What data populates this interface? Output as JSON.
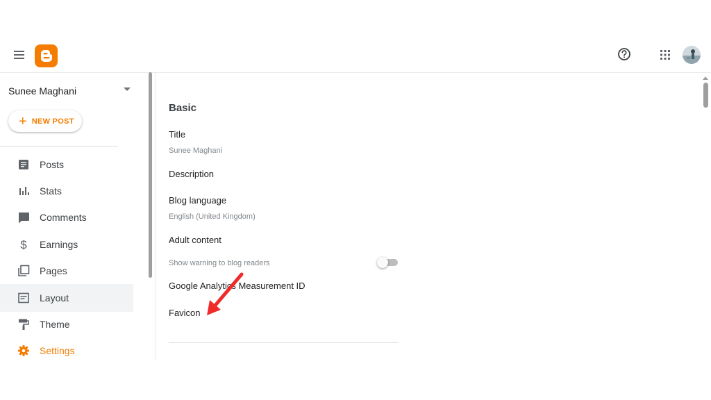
{
  "header": {
    "menu_icon": "hamburger-menu-icon",
    "logo_icon": "blogger-logo",
    "help_icon": "help-circle-icon",
    "apps_icon": "apps-grid-icon",
    "accent_color": "#f57c00"
  },
  "sidebar": {
    "blog_name": "Sunee Maghani",
    "new_post_label": "NEW POST",
    "items": [
      {
        "label": "Posts",
        "icon": "posts-icon"
      },
      {
        "label": "Stats",
        "icon": "stats-icon"
      },
      {
        "label": "Comments",
        "icon": "comments-icon"
      },
      {
        "label": "Earnings",
        "icon": "dollar-icon"
      },
      {
        "label": "Pages",
        "icon": "pages-icon"
      },
      {
        "label": "Layout",
        "icon": "layout-icon"
      },
      {
        "label": "Theme",
        "icon": "paint-roller-icon"
      },
      {
        "label": "Settings",
        "icon": "gear-icon"
      }
    ]
  },
  "main": {
    "section_title": "Basic",
    "fields": [
      {
        "label": "Title",
        "value": "Sunee Maghani"
      },
      {
        "label": "Description"
      },
      {
        "label": "Blog language",
        "value": "English (United Kingdom)"
      },
      {
        "label": "Adult content",
        "value": "Show warning to blog readers",
        "toggle": "off"
      },
      {
        "label": "Google Analytics Measurement ID"
      },
      {
        "label": "Favicon"
      }
    ]
  },
  "annotation": {
    "arrow_color": "#f02a2a"
  }
}
